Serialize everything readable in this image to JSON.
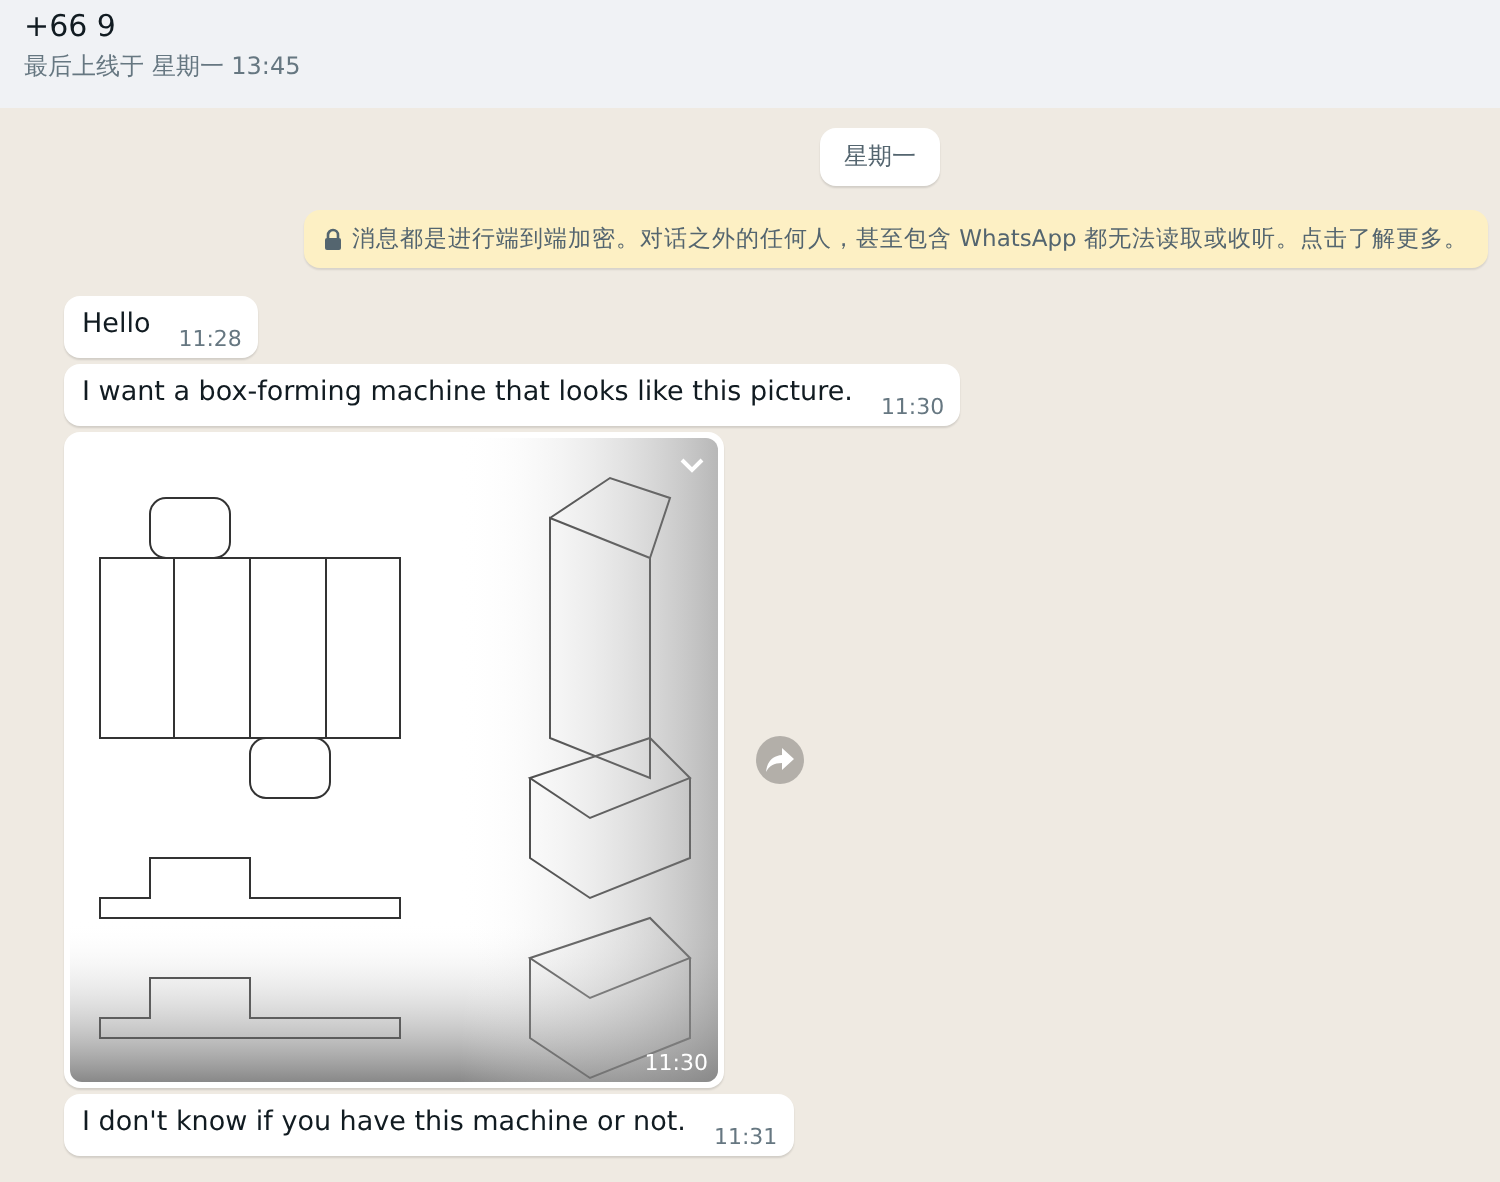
{
  "header": {
    "contact": "+66 9",
    "status": "最后上线于 星期一 13:45"
  },
  "date_chip": "星期一",
  "encryption_notice": "消息都是进行端到端加密。对话之外的任何人，甚至包含 WhatsApp 都无法读取或收听。点击了解更多。",
  "messages": [
    {
      "kind": "text",
      "text": "Hello",
      "time": "11:28"
    },
    {
      "kind": "text",
      "text": "I want a box-forming machine that looks like this picture.",
      "time": "11:30"
    },
    {
      "kind": "image",
      "time": "11:30"
    },
    {
      "kind": "text",
      "text": "I don't know if you have this machine or not.",
      "time": "11:31"
    }
  ]
}
